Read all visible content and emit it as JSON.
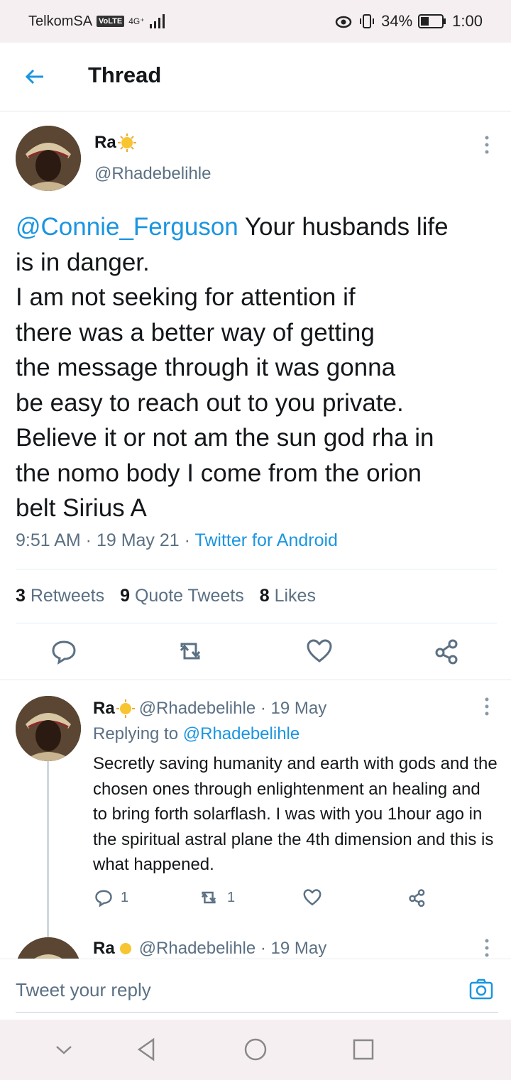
{
  "status_bar": {
    "carrier": "TelkomSA",
    "volte": "VoLTE",
    "network": "4G⁺",
    "battery_percent": "34%",
    "time": "1:00"
  },
  "header": {
    "title": "Thread",
    "back_icon": "arrow-left-icon"
  },
  "main_tweet": {
    "name": "Ra",
    "name_emoji": "sun-emoji",
    "handle": "@Rhadebelihle",
    "mention": "@Connie_Ferguson",
    "text": " Your husbands life\nis in danger.\nI am not seeking for attention if\nthere was a better way of getting\nthe message through it was gonna\nbe easy to reach out to you private.\nBelieve it or not am the sun god rha in\nthe nomo body I come from the orion\nbelt Sirius A",
    "time": "9:51 AM",
    "date": "19 May 21",
    "source": "Twitter for Android",
    "retweets_count": "3",
    "retweets_label": "Retweets",
    "quotes_count": "9",
    "quotes_label": "Quote Tweets",
    "likes_count": "8",
    "likes_label": "Likes"
  },
  "reply_tweet": {
    "name": "Ra",
    "handle_date": "@Rhadebelihle · 19 May",
    "replying_label": "Replying to ",
    "replying_to": "@Rhadebelihle",
    "text": "Secretly saving humanity and earth with gods and the chosen ones through enlightenment an healing and to bring forth solarflash. I was with you 1hour ago in the spiritual astral plane the 4th dimension and this is what happened.",
    "reply_count": "1",
    "retweet_count": "1"
  },
  "next_tweet": {
    "name": "Ra",
    "handle_date": "@Rhadebelihle · 19 May"
  },
  "reply_bar": {
    "placeholder": "Tweet your reply"
  },
  "colors": {
    "accent": "#1b95e0",
    "secondary_text": "#5b7083"
  }
}
